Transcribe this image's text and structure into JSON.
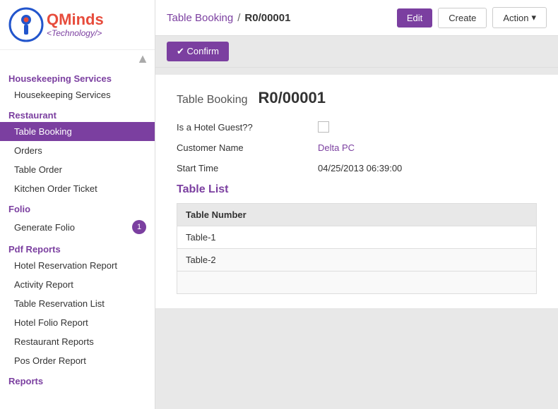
{
  "sidebar": {
    "logo": {
      "minds_text": "Minds",
      "tech_text": "<Technology/>"
    },
    "sections": [
      {
        "header": "Housekeeping Services",
        "items": [
          {
            "label": "Housekeeping Services",
            "active": false
          }
        ]
      },
      {
        "header": "Restaurant",
        "items": [
          {
            "label": "Table Booking",
            "active": true
          },
          {
            "label": "Orders",
            "active": false
          },
          {
            "label": "Table Order",
            "active": false
          },
          {
            "label": "Kitchen Order Ticket",
            "active": false
          }
        ]
      },
      {
        "header": "Folio",
        "items": [
          {
            "label": "Generate Folio",
            "active": false,
            "badge": "1"
          }
        ]
      },
      {
        "header": "Pdf Reports",
        "items": [
          {
            "label": "Hotel Reservation Report",
            "active": false
          },
          {
            "label": "Activity Report",
            "active": false
          },
          {
            "label": "Table Reservation List",
            "active": false
          },
          {
            "label": "Hotel Folio Report",
            "active": false
          },
          {
            "label": "Restaurant Reports",
            "active": false
          },
          {
            "label": "Pos Order Report",
            "active": false
          }
        ]
      },
      {
        "header": "Reports",
        "items": []
      }
    ]
  },
  "topbar": {
    "breadcrumb_link": "Table Booking",
    "breadcrumb_separator": "/",
    "breadcrumb_current": "R0/00001",
    "btn_edit": "Edit",
    "btn_create": "Create",
    "btn_action": "Action",
    "chevron": "▾"
  },
  "actionbar": {
    "btn_confirm": "✔ Confirm"
  },
  "record": {
    "label": "Table Booking",
    "id": "R0/00001",
    "is_hotel_guest_label": "Is a Hotel Guest??",
    "customer_name_label": "Customer Name",
    "customer_name_value": "Delta PC",
    "start_time_label": "Start Time",
    "start_time_value": "04/25/2013 06:39:00"
  },
  "table_list": {
    "section_title": "Table List",
    "column_header": "Table Number",
    "rows": [
      {
        "table_number": "Table-1"
      },
      {
        "table_number": "Table-2"
      }
    ]
  }
}
